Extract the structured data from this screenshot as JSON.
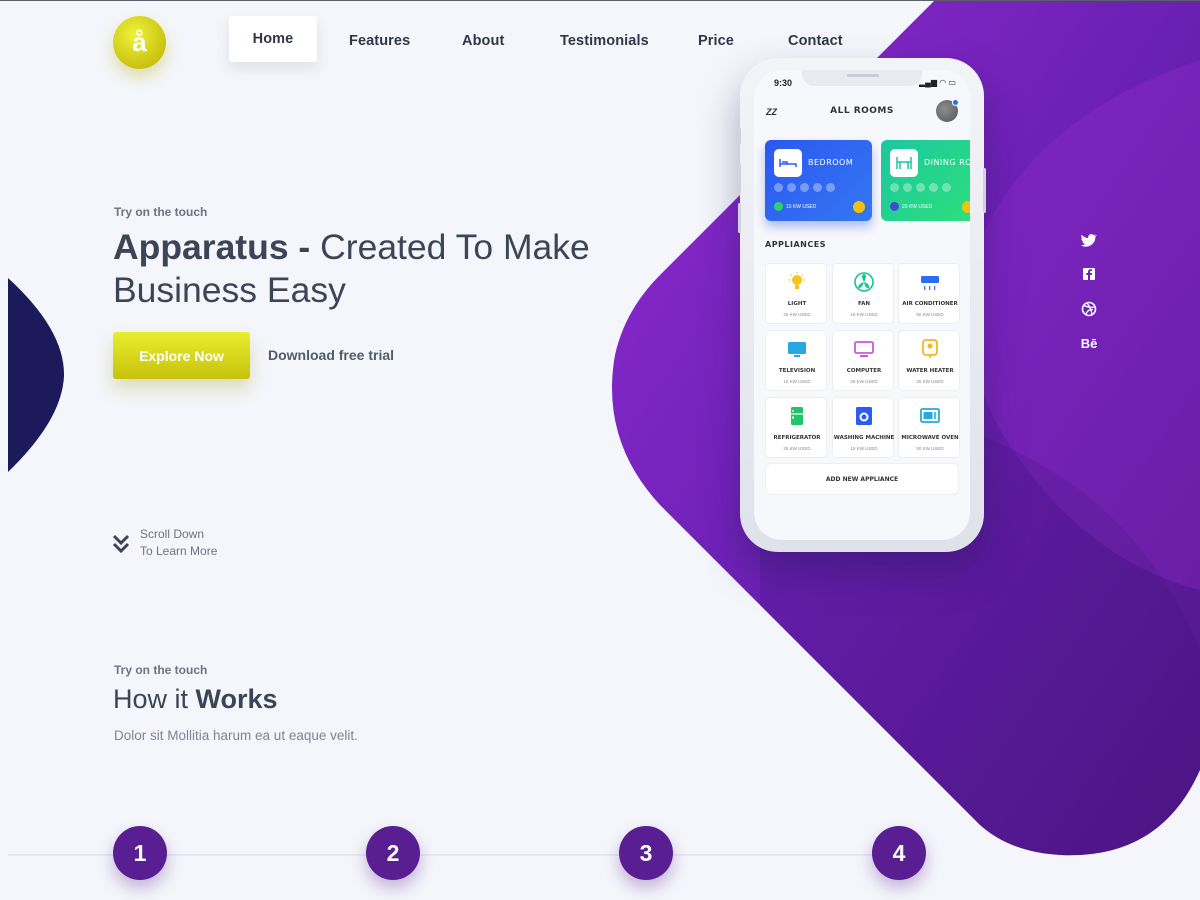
{
  "brand": {
    "logo_letter": "å"
  },
  "nav": {
    "items": [
      "Home",
      "Features",
      "About",
      "Testimonials",
      "Price",
      "Contact"
    ],
    "active": "Home"
  },
  "hero": {
    "eyebrow": "Try on the touch",
    "title_strong": "Apparatus -",
    "title_rest": " Created To Make Business Easy",
    "primary_button": "Explore Now",
    "secondary_link": "Download free trial"
  },
  "scroll": {
    "line1": "Scroll Down",
    "line2": "To Learn More"
  },
  "how": {
    "eyebrow": "Try on the touch",
    "title_normal": "How it ",
    "title_strong": "Works",
    "description": "Dolor sit Mollitia harum ea ut eaque velit.",
    "steps": [
      "1",
      "2",
      "3",
      "4"
    ]
  },
  "social": [
    "twitter-icon",
    "facebook-icon",
    "dribbble-icon",
    "behance-icon"
  ],
  "social_glyphs": {
    "behance": "Bē"
  },
  "phone": {
    "time": "9:30",
    "status": "▂▄▆ ◠ ▭",
    "menu_icon": "ZZ",
    "title": "ALL ROOMS",
    "rooms": [
      {
        "name": "BEDROOM",
        "usage": "15 KW USED"
      },
      {
        "name": "DINING ROOM",
        "usage": "20 KW USED"
      }
    ],
    "appliances_heading": "APPLIANCES",
    "appliances": [
      {
        "name": "LIGHT",
        "usage": "25 KW USED",
        "icon": "bulb-icon",
        "color": "#f5c518"
      },
      {
        "name": "FAN",
        "usage": "15 KW USED",
        "icon": "fan-icon",
        "color": "#18c48f"
      },
      {
        "name": "AIR CONDITIONER",
        "usage": "50 KW USED",
        "icon": "ac-icon",
        "color": "#2d6cf2"
      },
      {
        "name": "TELEVISION",
        "usage": "10 KW USED",
        "icon": "tv-icon",
        "color": "#28a8e0"
      },
      {
        "name": "COMPUTER",
        "usage": "25 KW USED",
        "icon": "computer-icon",
        "color": "#c85ad8"
      },
      {
        "name": "WATER HEATER",
        "usage": "25 KW USED",
        "icon": "water-heater-icon",
        "color": "#f5b818"
      },
      {
        "name": "REFRIGERATOR",
        "usage": "25 KW USED",
        "icon": "fridge-icon",
        "color": "#22c46a"
      },
      {
        "name": "WASHING MACHINE",
        "usage": "15 KW USED",
        "icon": "washer-icon",
        "color": "#2d5cf2"
      },
      {
        "name": "MICROWAVE OVEN",
        "usage": "50 KW USED",
        "icon": "microwave-icon",
        "color": "#28a8e0"
      }
    ],
    "add_button": "ADD NEW APPLIANCE"
  },
  "colors": {
    "accent_yellow": "#d9d61c",
    "purple_dark": "#5a1e93",
    "purple_light": "#8a2bd0",
    "navy": "#1d1a5c"
  }
}
